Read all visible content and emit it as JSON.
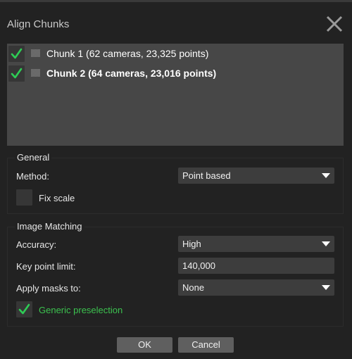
{
  "dialog": {
    "title": "Align Chunks",
    "close_icon": "close-icon"
  },
  "chunks": [
    {
      "label": "Chunk 1 (62 cameras, 23,325 points)",
      "checked": true,
      "bold": false,
      "icon": "chunk-icon"
    },
    {
      "label": "Chunk 2 (64 cameras, 23,016 points)",
      "checked": true,
      "bold": true,
      "icon": "chunk-icon"
    }
  ],
  "general": {
    "title": "General",
    "method_label": "Method:",
    "method_value": "Point based",
    "fix_scale_label": "Fix scale",
    "fix_scale_checked": false
  },
  "image_matching": {
    "title": "Image Matching",
    "accuracy_label": "Accuracy:",
    "accuracy_value": "High",
    "key_point_limit_label": "Key point limit:",
    "key_point_limit_value": "140,000",
    "apply_masks_label": "Apply masks to:",
    "apply_masks_value": "None",
    "generic_preselection_label": "Generic preselection",
    "generic_preselection_checked": true
  },
  "buttons": {
    "ok": "OK",
    "cancel": "Cancel"
  },
  "colors": {
    "background": "#222222",
    "check_green": "#2ecc55",
    "label_green": "#3cc24f"
  }
}
